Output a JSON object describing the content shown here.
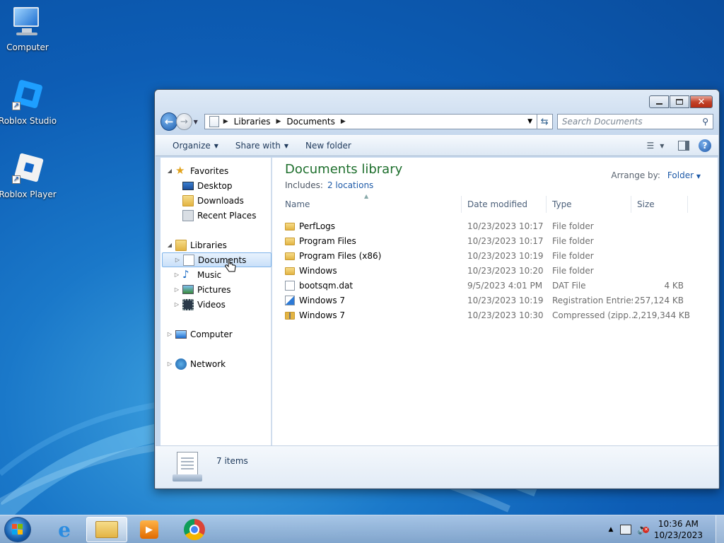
{
  "desktop": {
    "icons": [
      {
        "label": "Computer",
        "icon": "computer-icon"
      },
      {
        "label": "Roblox Studio",
        "icon": "roblox-studio-icon"
      },
      {
        "label": "Roblox Player",
        "icon": "roblox-player-icon"
      }
    ]
  },
  "window": {
    "breadcrumb": [
      "Libraries",
      "Documents"
    ],
    "search_placeholder": "Search Documents",
    "toolbar": {
      "organize": "Organize",
      "share_with": "Share with",
      "new_folder": "New folder"
    },
    "nav": {
      "favorites": "Favorites",
      "desktop": "Desktop",
      "downloads": "Downloads",
      "recent_places": "Recent Places",
      "libraries": "Libraries",
      "documents": "Documents",
      "music": "Music",
      "pictures": "Pictures",
      "videos": "Videos",
      "computer": "Computer",
      "network": "Network"
    },
    "library": {
      "title": "Documents library",
      "includes_label": "Includes:",
      "includes_link": "2 locations",
      "arrange_label": "Arrange by:",
      "arrange_value": "Folder"
    },
    "columns": [
      "Name",
      "Date modified",
      "Type",
      "Size"
    ],
    "files": [
      {
        "name": "PerfLogs",
        "date": "10/23/2023 10:17 ...",
        "type": "File folder",
        "size": "",
        "icon": "folder-icon"
      },
      {
        "name": "Program Files",
        "date": "10/23/2023 10:17 ...",
        "type": "File folder",
        "size": "",
        "icon": "folder-icon"
      },
      {
        "name": "Program Files (x86)",
        "date": "10/23/2023 10:19 ...",
        "type": "File folder",
        "size": "",
        "icon": "folder-icon"
      },
      {
        "name": "Windows",
        "date": "10/23/2023 10:20 ...",
        "type": "File folder",
        "size": "",
        "icon": "folder-icon"
      },
      {
        "name": "bootsqm.dat",
        "date": "9/5/2023 4:01 PM",
        "type": "DAT File",
        "size": "4 KB",
        "icon": "file-icon"
      },
      {
        "name": "Windows 7",
        "date": "10/23/2023 10:19 ...",
        "type": "Registration Entries",
        "size": "257,124 KB",
        "icon": "registry-file-icon"
      },
      {
        "name": "Windows 7",
        "date": "10/23/2023 10:30 ...",
        "type": "Compressed (zipp...",
        "size": "2,219,344 KB",
        "icon": "zip-folder-icon"
      }
    ],
    "status": {
      "item_count": "7 items"
    }
  },
  "taskbar": {
    "apps": [
      "internet-explorer-icon",
      "windows-explorer-icon",
      "media-player-icon",
      "chrome-icon"
    ],
    "clock_time": "10:36 AM",
    "clock_date": "10/23/2023"
  }
}
